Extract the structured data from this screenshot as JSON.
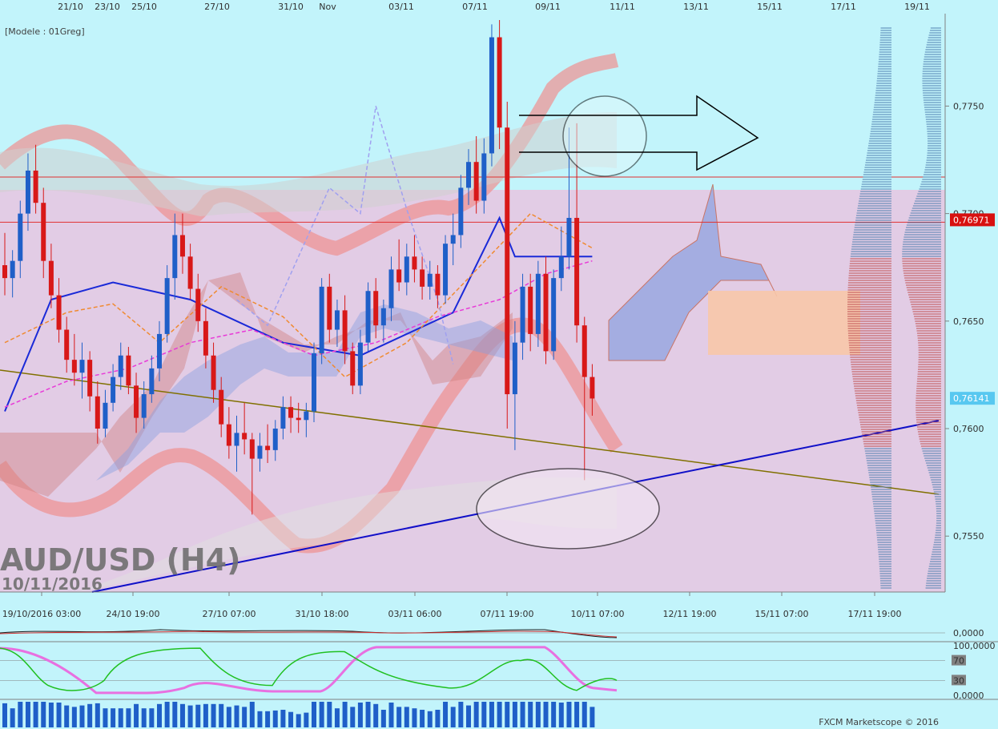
{
  "header": {
    "model_label": "[Modele : 01Greg]",
    "watermark_symbol": "AUD/USD (H4)",
    "watermark_date": "10/11/2016",
    "footer": "FXCM Marketscope © 2016"
  },
  "chart_data": {
    "type": "candlestick",
    "symbol": "AUD/USD",
    "timeframe": "H4",
    "top_date_labels": [
      "21/10",
      "23/10",
      "25/10",
      "27/10",
      "31/10",
      "Nov",
      "03/11",
      "07/11",
      "09/11",
      "11/11",
      "13/11",
      "15/11",
      "17/11",
      "19/11"
    ],
    "bottom_time_labels": [
      "19/10/2016 03:00",
      "24/10 19:00",
      "27/10 07:00",
      "31/10 18:00",
      "03/11 06:00",
      "07/11 19:00",
      "10/11 07:00",
      "12/11 19:00",
      "15/11 07:00",
      "17/11 19:00"
    ],
    "price_axis": {
      "ylim": [
        0.7524,
        0.7793
      ],
      "ticks": [
        "0,7750",
        "0,7700",
        "0,7650",
        "0,7600",
        "0,7550"
      ],
      "price_badges": [
        {
          "label": "0,76971",
          "value": 0.76971,
          "color": "#d81010"
        },
        {
          "label": "0,76141",
          "value": 0.76141,
          "color": "#58c8f0"
        }
      ]
    },
    "horizontal_levels": [
      0.7717,
      0.7696
    ],
    "candles_ohlc": [
      [
        0.7676,
        0.7691,
        0.7662,
        0.767
      ],
      [
        0.767,
        0.7683,
        0.7661,
        0.7678
      ],
      [
        0.7678,
        0.7706,
        0.767,
        0.77
      ],
      [
        0.77,
        0.7728,
        0.7692,
        0.772
      ],
      [
        0.772,
        0.7732,
        0.77,
        0.7705
      ],
      [
        0.7705,
        0.7712,
        0.767,
        0.7678
      ],
      [
        0.7678,
        0.7686,
        0.7656,
        0.7662
      ],
      [
        0.7662,
        0.767,
        0.764,
        0.7646
      ],
      [
        0.7646,
        0.7652,
        0.7626,
        0.7632
      ],
      [
        0.7632,
        0.7644,
        0.762,
        0.7626
      ],
      [
        0.7626,
        0.764,
        0.7614,
        0.7632
      ],
      [
        0.7632,
        0.7636,
        0.7608,
        0.7615
      ],
      [
        0.7615,
        0.7622,
        0.7593,
        0.76
      ],
      [
        0.76,
        0.7618,
        0.7596,
        0.7612
      ],
      [
        0.7612,
        0.763,
        0.7608,
        0.7624
      ],
      [
        0.7624,
        0.764,
        0.7618,
        0.7634
      ],
      [
        0.7634,
        0.7638,
        0.7616,
        0.762
      ],
      [
        0.762,
        0.7626,
        0.7598,
        0.7605
      ],
      [
        0.7605,
        0.7622,
        0.76,
        0.7616
      ],
      [
        0.7616,
        0.7634,
        0.7612,
        0.7628
      ],
      [
        0.7628,
        0.765,
        0.7622,
        0.7644
      ],
      [
        0.7644,
        0.7676,
        0.764,
        0.767
      ],
      [
        0.767,
        0.77,
        0.766,
        0.769
      ],
      [
        0.769,
        0.77,
        0.7672,
        0.768
      ],
      [
        0.768,
        0.7686,
        0.766,
        0.7665
      ],
      [
        0.7665,
        0.7672,
        0.7645,
        0.765
      ],
      [
        0.765,
        0.7656,
        0.7628,
        0.7634
      ],
      [
        0.7634,
        0.764,
        0.7612,
        0.7618
      ],
      [
        0.7618,
        0.7624,
        0.7596,
        0.7602
      ],
      [
        0.7602,
        0.761,
        0.7586,
        0.7592
      ],
      [
        0.7592,
        0.7606,
        0.758,
        0.7598
      ],
      [
        0.7598,
        0.7612,
        0.7588,
        0.7595
      ],
      [
        0.7595,
        0.7598,
        0.756,
        0.7586
      ],
      [
        0.7586,
        0.7598,
        0.758,
        0.7592
      ],
      [
        0.7592,
        0.7602,
        0.7584,
        0.759
      ],
      [
        0.759,
        0.7604,
        0.7585,
        0.76
      ],
      [
        0.76,
        0.7615,
        0.7595,
        0.761
      ],
      [
        0.761,
        0.7615,
        0.7598,
        0.7605
      ],
      [
        0.7605,
        0.7612,
        0.7598,
        0.7604
      ],
      [
        0.7604,
        0.7612,
        0.7596,
        0.7608
      ],
      [
        0.7608,
        0.764,
        0.7603,
        0.7635
      ],
      [
        0.7635,
        0.767,
        0.763,
        0.7666
      ],
      [
        0.7666,
        0.7672,
        0.764,
        0.7646
      ],
      [
        0.7646,
        0.766,
        0.7638,
        0.7655
      ],
      [
        0.7655,
        0.7662,
        0.763,
        0.7636
      ],
      [
        0.7636,
        0.764,
        0.7616,
        0.762
      ],
      [
        0.762,
        0.7646,
        0.7616,
        0.764
      ],
      [
        0.764,
        0.7668,
        0.7636,
        0.7664
      ],
      [
        0.7664,
        0.767,
        0.7642,
        0.7648
      ],
      [
        0.7648,
        0.766,
        0.764,
        0.7656
      ],
      [
        0.7656,
        0.768,
        0.765,
        0.7674
      ],
      [
        0.7674,
        0.7688,
        0.7664,
        0.7668
      ],
      [
        0.7668,
        0.7686,
        0.7662,
        0.768
      ],
      [
        0.768,
        0.769,
        0.7668,
        0.7674
      ],
      [
        0.7674,
        0.768,
        0.766,
        0.7666
      ],
      [
        0.7666,
        0.7678,
        0.766,
        0.7672
      ],
      [
        0.7672,
        0.7676,
        0.7656,
        0.7662
      ],
      [
        0.7662,
        0.769,
        0.7658,
        0.7686
      ],
      [
        0.7686,
        0.77,
        0.7676,
        0.769
      ],
      [
        0.769,
        0.7718,
        0.7684,
        0.7712
      ],
      [
        0.7712,
        0.773,
        0.7704,
        0.7724
      ],
      [
        0.7724,
        0.7736,
        0.77,
        0.7706
      ],
      [
        0.7706,
        0.7735,
        0.77,
        0.7728
      ],
      [
        0.7728,
        0.7788,
        0.7722,
        0.7782
      ],
      [
        0.7782,
        0.779,
        0.773,
        0.774
      ],
      [
        0.774,
        0.7752,
        0.76,
        0.7616
      ],
      [
        0.7616,
        0.765,
        0.759,
        0.764
      ],
      [
        0.764,
        0.7672,
        0.7632,
        0.7666
      ],
      [
        0.7666,
        0.7672,
        0.7636,
        0.7644
      ],
      [
        0.7644,
        0.7678,
        0.7638,
        0.7672
      ],
      [
        0.7672,
        0.768,
        0.763,
        0.7636
      ],
      [
        0.7636,
        0.7674,
        0.7632,
        0.767
      ],
      [
        0.767,
        0.7694,
        0.7664,
        0.768
      ],
      [
        0.768,
        0.774,
        0.7674,
        0.7698
      ],
      [
        0.7698,
        0.7742,
        0.764,
        0.7648
      ],
      [
        0.7648,
        0.7652,
        0.7576,
        0.7624
      ],
      [
        0.7624,
        0.763,
        0.7606,
        0.7614
      ]
    ],
    "series": [
      {
        "name": "",
        "color": "#1a2ad8",
        "points": [
          [
            0,
            0.7608
          ],
          [
            6,
            0.766
          ],
          [
            14,
            0.7668
          ],
          [
            24,
            0.766
          ],
          [
            36,
            0.764
          ],
          [
            46,
            0.7634
          ],
          [
            58,
            0.7654
          ],
          [
            64,
            0.7698
          ],
          [
            66,
            0.768
          ],
          [
            76,
            0.768
          ]
        ]
      },
      {
        "name": "",
        "color": "#e83ad8",
        "points": [
          [
            0,
            0.761
          ],
          [
            8,
            0.7622
          ],
          [
            16,
            0.7628
          ],
          [
            24,
            0.764
          ],
          [
            32,
            0.7646
          ],
          [
            40,
            0.7634
          ],
          [
            48,
            0.764
          ],
          [
            56,
            0.7652
          ],
          [
            64,
            0.766
          ],
          [
            70,
            0.7672
          ],
          [
            76,
            0.7678
          ]
        ]
      },
      {
        "name": "",
        "color": "#f08a30",
        "points": [
          [
            0,
            0.764
          ],
          [
            8,
            0.7654
          ],
          [
            14,
            0.7658
          ],
          [
            20,
            0.764
          ],
          [
            28,
            0.7666
          ],
          [
            36,
            0.7652
          ],
          [
            44,
            0.7624
          ],
          [
            52,
            0.764
          ],
          [
            60,
            0.767
          ],
          [
            68,
            0.77
          ],
          [
            76,
            0.7684
          ]
        ]
      },
      {
        "name": "",
        "color": "#a0a0f0",
        "points": [
          [
            30,
            0.766
          ],
          [
            34,
            0.7648
          ],
          [
            38,
            0.768
          ],
          [
            42,
            0.7712
          ],
          [
            46,
            0.77
          ],
          [
            48,
            0.775
          ],
          [
            52,
            0.7702
          ],
          [
            56,
            0.766
          ],
          [
            58,
            0.763
          ]
        ]
      }
    ],
    "volume_profile_range": [
      0.7524,
      0.7793
    ],
    "oscillator_panels": [
      {
        "ticks": [
          "0,0000"
        ]
      },
      {
        "ticks": [
          "100,0000",
          "70",
          "30",
          "0,0000"
        ]
      }
    ]
  }
}
